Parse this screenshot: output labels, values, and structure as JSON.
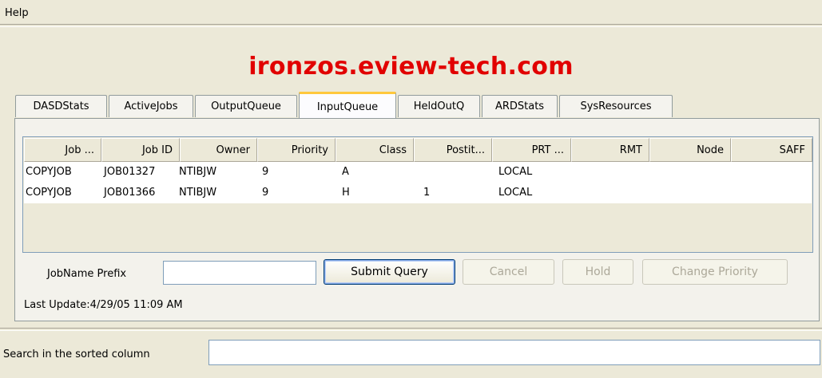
{
  "menu": {
    "help": "Help"
  },
  "host_title": "ironzos.eview-tech.com",
  "tabs": [
    "DASDStats",
    "ActiveJobs",
    "OutputQueue",
    "InputQueue",
    "HeldOutQ",
    "ARDStats",
    "SysResources"
  ],
  "active_tab": "InputQueue",
  "table": {
    "columns": [
      "Job ...",
      "Job ID",
      "Owner",
      "Priority",
      "Class",
      "Postit...",
      "PRT ...",
      "RMT",
      "Node",
      "SAFF"
    ],
    "rows": [
      [
        "COPYJOB",
        "JOB01327",
        "NTIBJW",
        "9",
        "A",
        "",
        "LOCAL",
        "",
        "",
        ""
      ],
      [
        "COPYJOB",
        "JOB01366",
        "NTIBJW",
        "9",
        "H",
        "1",
        "LOCAL",
        "",
        "",
        ""
      ]
    ]
  },
  "query": {
    "prefix_label": "JobName Prefix",
    "prefix_value": "",
    "submit_label": "Submit Query",
    "cancel_label": "Cancel",
    "hold_label": "Hold",
    "change_priority_label": "Change Priority"
  },
  "last_update": "Last Update:4/29/05 11:09 AM",
  "search": {
    "label": "Search in the sorted column",
    "value": ""
  }
}
